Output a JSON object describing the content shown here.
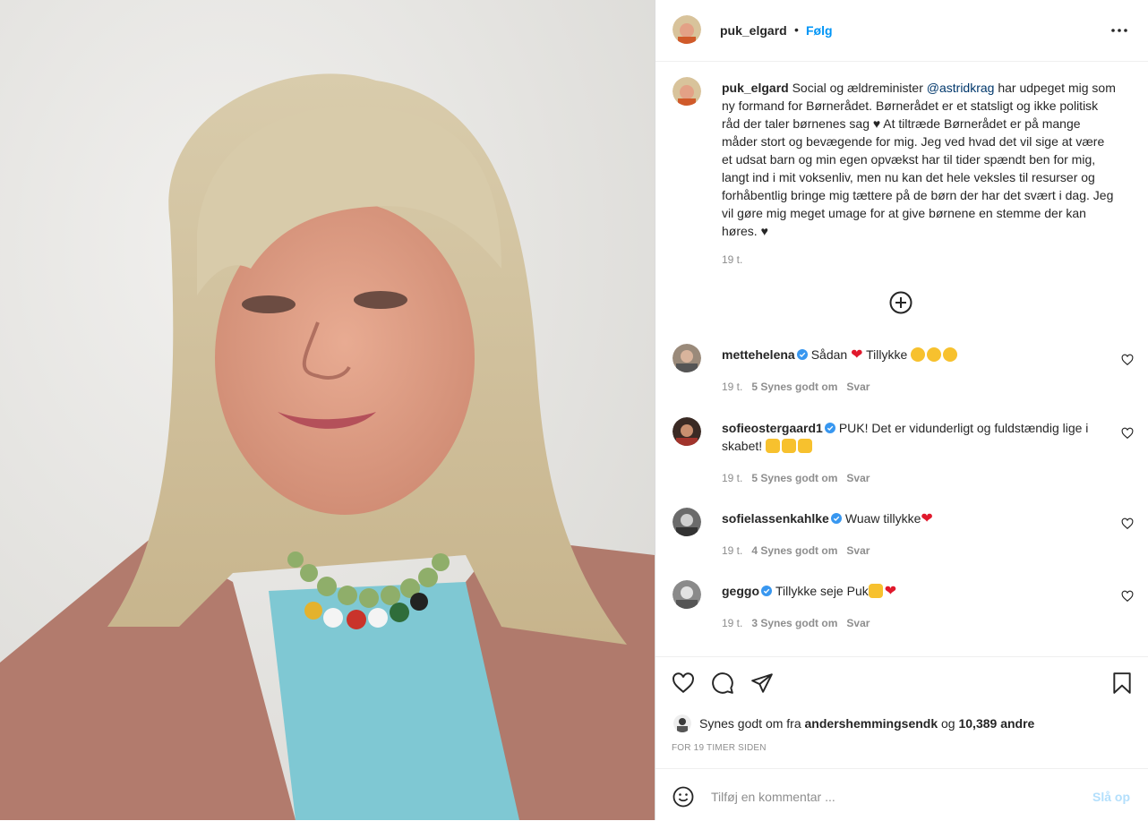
{
  "post": {
    "username": "puk_elgard",
    "follow_label": "Følg",
    "separator": "•",
    "caption": {
      "text_before": "Social og ældreminister ",
      "mention": "@astridkrag",
      "text_after": " har udpeget mig som ny formand for Børnerådet. Børnerådet er et statsligt og ikke politisk råd der taler børnenes sag ♥ At tiltræde Børnerådet er på mange måder stort og bevægende for mig. Jeg ved hvad det vil sige at være et udsat barn og min egen opvækst har til tider spændt ben for mig, langt ind i mit voksenliv, men nu kan det hele veksles til resurser og forhåbentlig bringe mig tættere på de børn der har det svært i dag. Jeg vil gøre mig meget umage for at give børnene en stemme der kan høres. ♥",
      "time": "19 t."
    }
  },
  "comments": [
    {
      "username": "mettehelena",
      "text": "Sådan",
      "text2": "Tillykke",
      "time": "19 t.",
      "likes": "5 Synes godt om",
      "reply": "Svar"
    },
    {
      "username": "sofieostergaard1",
      "text": "PUK! Det er vidunderligt og fuldstændig lige i skabet!",
      "time": "19 t.",
      "likes": "5 Synes godt om",
      "reply": "Svar"
    },
    {
      "username": "sofielassenkahlke",
      "text": "Wuaw tillykke",
      "time": "19 t.",
      "likes": "4 Synes godt om",
      "reply": "Svar"
    },
    {
      "username": "geggo",
      "text": "Tillykke seje Puk",
      "time": "19 t.",
      "likes": "3 Synes godt om",
      "reply": "Svar"
    }
  ],
  "footer": {
    "likes_prefix": "Synes godt om fra",
    "likes_user": "andershemmingsendk",
    "likes_and": "og",
    "likes_count": "10,389 andre",
    "ago": "FOR 19 TIMER SIDEN"
  },
  "composer": {
    "placeholder": "Tilføj en kommentar ...",
    "post_label": "Slå op"
  },
  "colors": {
    "accent": "#0095f6",
    "mention": "#00376b",
    "muted": "#8e8e8e",
    "verified": "#3897f0"
  }
}
